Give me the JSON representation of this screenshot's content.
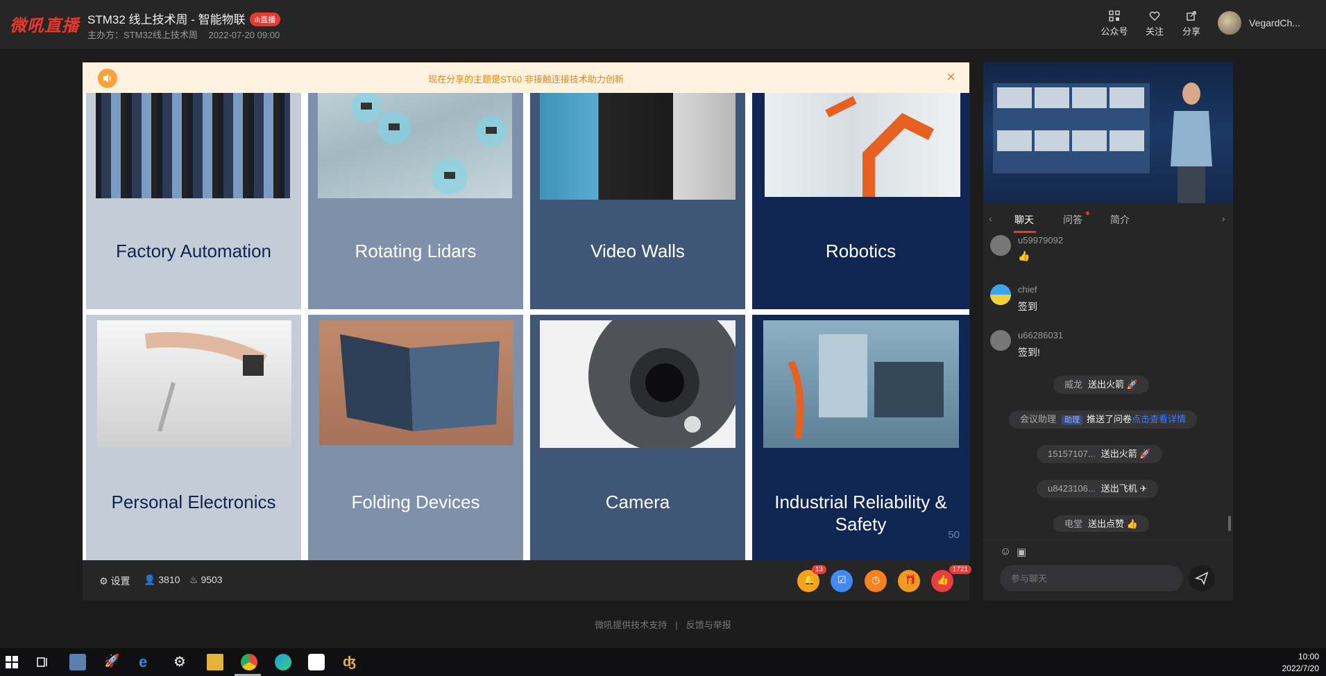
{
  "header": {
    "logo": "微吼直播",
    "title": "STM32 线上技术周 - 智能物联",
    "live_badge": "直播",
    "organizer": "主办方：STM32线上技术周",
    "datetime": "2022-07-20 09:00",
    "actions": [
      "公众号",
      "关注",
      "分享"
    ],
    "username": "VegardCh..."
  },
  "notice": {
    "text": "现在分享的主题是ST60 非接触连接技术助力创新"
  },
  "slide": {
    "tiles": [
      {
        "label": "Factory Automation",
        "bg": "#c4ccd7",
        "color": "#0f2450"
      },
      {
        "label": "Rotating Lidars",
        "bg": "#7f91aa",
        "color": "#ffffff"
      },
      {
        "label": "Video Walls",
        "bg": "#405677",
        "color": "#ffffff"
      },
      {
        "label": "Robotics",
        "bg": "#0e2651",
        "color": "#ffffff"
      },
      {
        "label": "Personal Electronics",
        "bg": "#c4ccd7",
        "color": "#0f2450"
      },
      {
        "label": "Folding Devices",
        "bg": "#7f91aa",
        "color": "#ffffff"
      },
      {
        "label": "Camera",
        "bg": "#405677",
        "color": "#ffffff"
      },
      {
        "label": "Industrial Reliability & Safety",
        "bg": "#0e2651",
        "color": "#ffffff"
      }
    ],
    "page_number": "50"
  },
  "controls": {
    "settings": "设置",
    "viewers": "3810",
    "heat": "9503",
    "bell_badge": "13",
    "like_badge": "1721"
  },
  "chat": {
    "tabs": [
      "聊天",
      "问答",
      "简介"
    ],
    "messages": [
      {
        "name": "u59979092",
        "text": "👍"
      },
      {
        "name": "chief",
        "text": "签到"
      },
      {
        "name": "u66286031",
        "text": "签到!"
      }
    ],
    "system": [
      {
        "name": "威龙",
        "action": "送出火箭",
        "icon": "🚀"
      },
      {
        "name": "会议助理",
        "tag": "助理",
        "action": "推送了问卷",
        "link": "点击查看详情"
      },
      {
        "name": "15157107...",
        "action": "送出火箭",
        "icon": "🚀"
      },
      {
        "name": "u8423106...",
        "action": "送出飞机",
        "icon": "✈"
      },
      {
        "name": "电堂",
        "action": "送出点赞",
        "icon": "👍"
      }
    ],
    "input_placeholder": "参与聊天"
  },
  "footer": {
    "support": "微吼提供技术支持",
    "separator": "|",
    "report": "反馈与举报"
  },
  "taskbar": {
    "time": "10:00",
    "date": "2022/7/20"
  }
}
